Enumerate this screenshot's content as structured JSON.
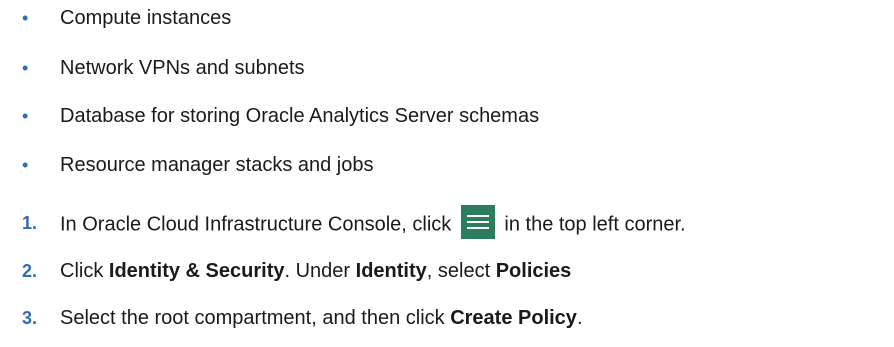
{
  "bullets": [
    "Compute instances",
    "Network VPNs and subnets",
    "Database for storing Oracle Analytics Server schemas",
    "Resource manager stacks and jobs"
  ],
  "bullet_glyph": "•",
  "steps": [
    {
      "number": "1.",
      "before": "In Oracle Cloud Infrastructure Console, click ",
      "icon": "hamburger-menu-icon",
      "after": " in the top left corner."
    },
    {
      "number": "2.",
      "parts": [
        {
          "text": "Click ",
          "bold": false
        },
        {
          "text": "Identity & Security",
          "bold": true
        },
        {
          "text": ". Under ",
          "bold": false
        },
        {
          "text": "Identity",
          "bold": true
        },
        {
          "text": ", select ",
          "bold": false
        },
        {
          "text": "Policies",
          "bold": true
        }
      ]
    },
    {
      "number": "3.",
      "parts": [
        {
          "text": "Select the root compartment, and then click ",
          "bold": false
        },
        {
          "text": "Create Policy",
          "bold": true
        },
        {
          "text": ".",
          "bold": false
        }
      ]
    }
  ],
  "colors": {
    "accent": "#2f6fab",
    "menu_button": "#2b7d5e"
  }
}
